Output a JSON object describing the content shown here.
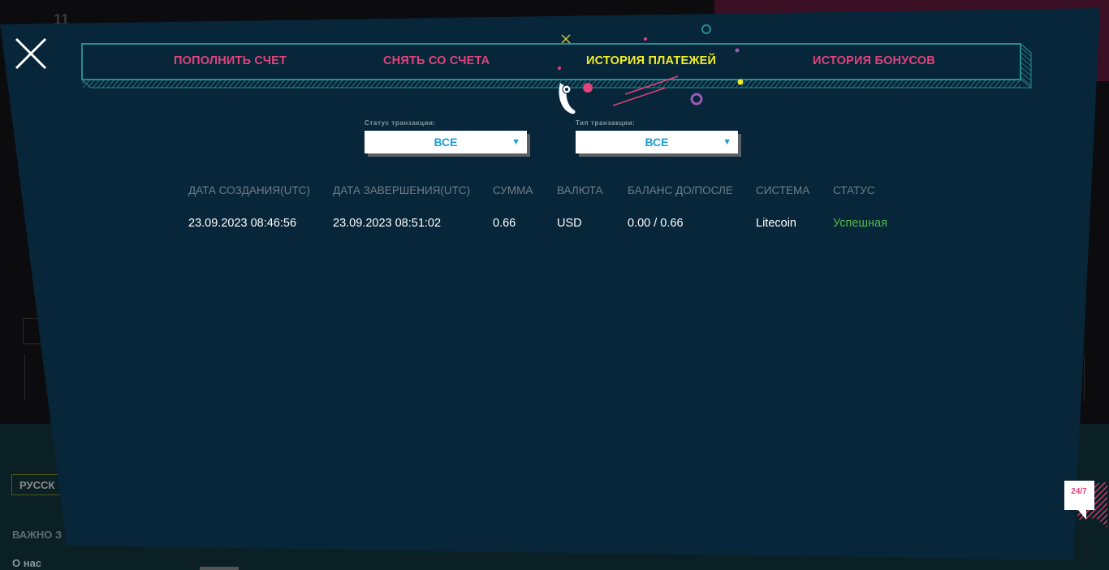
{
  "background": {
    "logo_fragment": "11",
    "language_label": "РУССК",
    "important_label": "ВАЖНО З",
    "about_label": "О нас"
  },
  "modal": {
    "close_icon": "close-icon",
    "tabs": [
      {
        "label": "ПОПОЛНИТЬ СЧЕТ",
        "active": false
      },
      {
        "label": "СНЯТЬ СО СЧЕТА",
        "active": false
      },
      {
        "label": "ИСТОРИЯ ПЛАТЕЖЕЙ",
        "active": true
      },
      {
        "label": "ИСТОРИЯ БОНУСОВ",
        "active": false
      }
    ],
    "filters": {
      "status": {
        "label": "Статус транзакции:",
        "value": "ВСЕ"
      },
      "type": {
        "label": "Тип транзакции:",
        "value": "ВСЕ"
      },
      "dropdown_icon": "triangle-down-icon"
    },
    "table": {
      "headers": [
        "ДАТА СОЗДАНИЯ(UTC)",
        "ДАТА ЗАВЕРШЕНИЯ(UTC)",
        "СУММА",
        "ВАЛЮТА",
        "БАЛАНС ДО/ПОСЛЕ",
        "СИСТЕМА",
        "СТАТУС"
      ],
      "rows": [
        [
          "23.09.2023 08:46:56",
          "23.09.2023 08:51:02",
          "0.66",
          "USD",
          "0.00 / 0.66",
          "Litecoin",
          "Успешная"
        ]
      ]
    },
    "support": {
      "label": "24/7"
    }
  },
  "colors": {
    "modal_bg": "#07263a",
    "tab_inactive": "#e2437a",
    "tab_active": "#f4ee24",
    "frame_teal": "#2a8a92",
    "select_text": "#1d9fd1",
    "status_success": "#4eb848"
  }
}
